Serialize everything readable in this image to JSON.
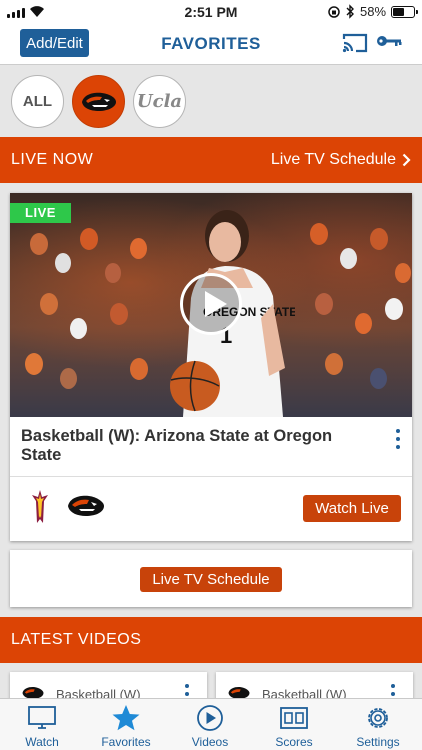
{
  "status_bar": {
    "time": "2:51 PM",
    "battery_text": "58%",
    "battery_level": 0.58
  },
  "nav": {
    "add_edit_label": "Add/Edit",
    "title": "FAVORITES"
  },
  "favorites": {
    "all_label": "ALL",
    "ucla_label": "Ucla"
  },
  "live_now": {
    "title": "LIVE NOW",
    "schedule_link": "Live TV Schedule"
  },
  "live_card": {
    "badge": "LIVE",
    "title": "Basketball (W): Arizona State at Oregon State",
    "jersey_text": "OREGON STATE",
    "jersey_number": "1",
    "watch_label": "Watch Live"
  },
  "schedule_card": {
    "button_label": "Live TV Schedule"
  },
  "latest_videos": {
    "title": "LATEST VIDEOS",
    "items": [
      {
        "label": "Basketball (W)"
      },
      {
        "label": "Basketball (W)"
      }
    ]
  },
  "tab_bar": {
    "tabs": [
      {
        "label": "Watch",
        "icon": "monitor-icon"
      },
      {
        "label": "Favorites",
        "icon": "star-icon"
      },
      {
        "label": "Videos",
        "icon": "play-circle-icon"
      },
      {
        "label": "Scores",
        "icon": "scoreboard-icon"
      },
      {
        "label": "Settings",
        "icon": "gear-icon"
      }
    ]
  },
  "colors": {
    "brand_blue": "#1f5f99",
    "osu_orange": "#dc4405",
    "live_green": "#2ec84a"
  }
}
